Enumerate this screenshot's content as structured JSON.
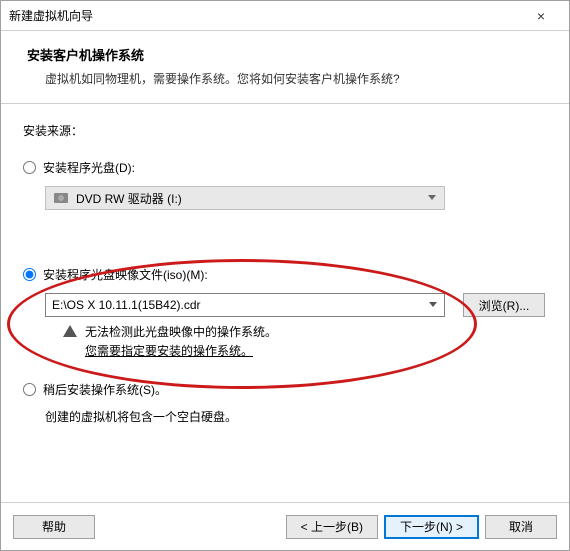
{
  "titlebar": {
    "title": "新建虚拟机向导",
    "close": "×"
  },
  "header": {
    "heading": "安装客户机操作系统",
    "subheading": "虚拟机如同物理机，需要操作系统。您将如何安装客户机操作系统?"
  },
  "content": {
    "source_label": "安装来源：",
    "opt_disc": {
      "label": "安装程序光盘(D):",
      "drive_text": "DVD RW 驱动器 (I:)"
    },
    "opt_iso": {
      "label": "安装程序光盘映像文件(iso)(M):",
      "path": "E:\\OS X 10.11.1(15B42).cdr",
      "browse": "浏览(R)...",
      "warn_line1": "无法检测此光盘映像中的操作系统。",
      "warn_line2": "您需要指定要安装的操作系统。"
    },
    "opt_later": {
      "label": "稍后安装操作系统(S)。",
      "desc": "创建的虚拟机将包含一个空白硬盘。"
    }
  },
  "footer": {
    "help": "帮助",
    "back": "< 上一步(B)",
    "next": "下一步(N) >",
    "cancel": "取消"
  }
}
